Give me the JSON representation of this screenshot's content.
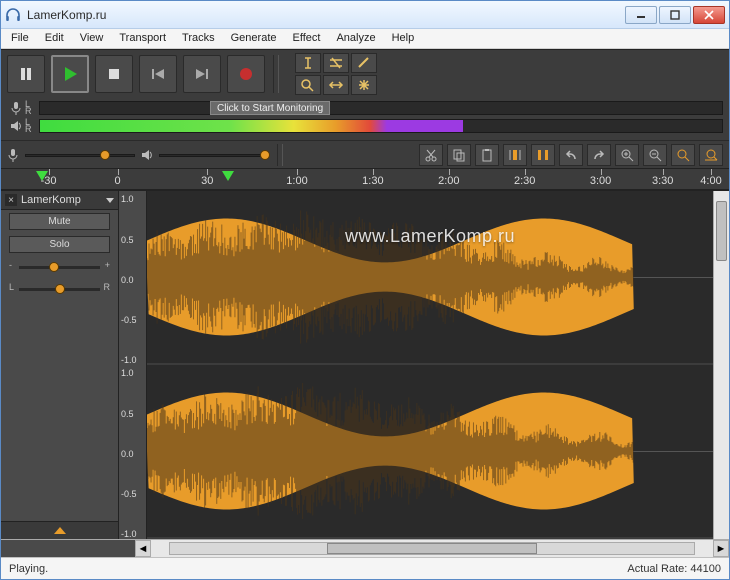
{
  "window": {
    "title": "LamerKomp.ru"
  },
  "menu": [
    "File",
    "Edit",
    "View",
    "Transport",
    "Tracks",
    "Generate",
    "Effect",
    "Analyze",
    "Help"
  ],
  "meters": {
    "click_to_monitor": "Click to Start Monitoring",
    "rec_channels": "L\nR",
    "play_channels": "L\nR",
    "play_fill_pct": 62
  },
  "sliders": {
    "rec_vol_pct": 68,
    "play_vol_pct": 92
  },
  "timeline": {
    "ticks": [
      {
        "pos": 4,
        "label": "-30"
      },
      {
        "pos": 14,
        "label": "0"
      },
      {
        "pos": 27,
        "label": "30"
      },
      {
        "pos": 40,
        "label": "1:00"
      },
      {
        "pos": 51,
        "label": "1:30"
      },
      {
        "pos": 62,
        "label": "2:00"
      },
      {
        "pos": 73,
        "label": "2:30"
      },
      {
        "pos": 84,
        "label": "3:00"
      },
      {
        "pos": 93,
        "label": "3:30"
      },
      {
        "pos": 100,
        "label": "4:00"
      }
    ],
    "pin_start_pct": 3,
    "pin_play_pct": 30
  },
  "track": {
    "name": "LamerKomp",
    "mute": "Mute",
    "solo": "Solo",
    "gain": {
      "left": "-",
      "right": "+",
      "pos_pct": 45
    },
    "pan": {
      "left": "L",
      "right": "R",
      "pos_pct": 50
    },
    "amp_labels": [
      "1.0",
      "0.5",
      "0.0",
      "-0.5",
      "-1.0"
    ]
  },
  "watermark": "www.LamerKomp.ru",
  "status": {
    "state": "Playing.",
    "rate_label": "Actual Rate:",
    "rate_value": "44100"
  },
  "colors": {
    "wave_fill": "#e89c2a",
    "wave_stroke": "#4a3418"
  }
}
